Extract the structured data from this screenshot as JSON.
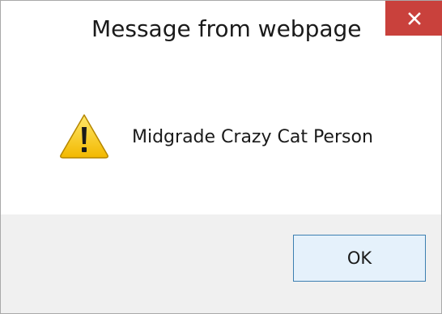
{
  "dialog": {
    "title": "Message from webpage",
    "message": "Midgrade Crazy Cat Person",
    "icon": "warning-icon",
    "close_icon": "close-icon",
    "ok_label": "OK"
  },
  "colors": {
    "close_button_bg": "#c9413c",
    "footer_bg": "#f0f0f0",
    "ok_border": "#3c7fb1",
    "ok_bg": "#e5f1fb",
    "warning_fill": "#f5c400"
  }
}
